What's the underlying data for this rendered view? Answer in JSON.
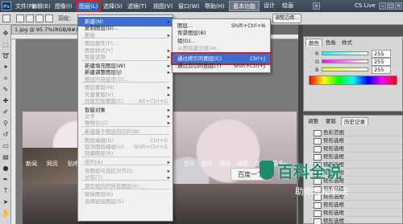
{
  "menubar": {
    "logo": "Ps",
    "items": [
      "文件(F)",
      "编辑(E)",
      "图像(I)",
      "图层(L)",
      "选择(S)",
      "滤镜(T)",
      "视图(V)",
      "窗口(W)",
      "帮助(H)"
    ],
    "zoom": "95.7",
    "workspace_buttons": [
      "基本功能",
      "设计",
      "绘画"
    ],
    "cs_live": "CS Live"
  },
  "options_bar": {
    "labels": [
      "羽化:"
    ],
    "refine_edge_button": "调整边缘..."
  },
  "document": {
    "tab_title": "1.jpg @ 95.7%(RGB/8#)"
  },
  "canvas": {
    "captions": [
      "新闻",
      "网页",
      "贴吧",
      "知道",
      "音乐",
      "图片",
      "视频",
      "地图",
      "文库",
      "更多»"
    ],
    "search_button": "百度一下"
  },
  "layer_menu": {
    "items": [
      {
        "label": "新建(N)",
        "state": "highlight",
        "submenu": true
      },
      {
        "label": "复制图层(D)...",
        "state": "normal"
      },
      {
        "label": "删除",
        "state": "dim",
        "submenu": true
      },
      {
        "sep": true
      },
      {
        "label": "图层属性(P)...",
        "state": "dim"
      },
      {
        "label": "图层样式(Y)",
        "state": "dim",
        "submenu": true
      },
      {
        "label": "智能滤镜",
        "state": "dim",
        "submenu": true
      },
      {
        "sep": true
      },
      {
        "label": "新建填充图层(W)",
        "state": "normal",
        "submenu": true
      },
      {
        "label": "新建调整图层(J)",
        "state": "normal",
        "submenu": true
      },
      {
        "label": "图层内容选项(O)...",
        "state": "dim"
      },
      {
        "sep": true
      },
      {
        "label": "图层蒙版(M)",
        "state": "dim",
        "submenu": true
      },
      {
        "label": "矢量蒙版(V)",
        "state": "dim",
        "submenu": true
      },
      {
        "label": "创建剪贴蒙版(C)",
        "state": "dim",
        "key": "Alt+Ctrl+G"
      },
      {
        "sep": true
      },
      {
        "label": "智能对象",
        "state": "normal",
        "submenu": true
      },
      {
        "label": "文字",
        "state": "dim",
        "submenu": true
      },
      {
        "label": "栅格化(Z)",
        "state": "dim",
        "submenu": true
      },
      {
        "sep": true
      },
      {
        "label": "新建基于图层的切片(B)",
        "state": "dim"
      },
      {
        "sep": true
      },
      {
        "label": "图层编组(G)",
        "state": "dim",
        "key": "Ctrl+G"
      },
      {
        "label": "取消图层编组(U)",
        "state": "dim",
        "key": "Shift+Ctrl+G"
      },
      {
        "label": "隐藏图层(R)",
        "state": "dim"
      },
      {
        "sep": true
      },
      {
        "label": "排列(A)",
        "state": "dim",
        "submenu": true
      },
      {
        "sep": true
      },
      {
        "label": "将图层与选区对齐(I)",
        "state": "dim",
        "submenu": true
      },
      {
        "label": "分布(T)",
        "state": "dim",
        "submenu": true
      },
      {
        "sep": true
      },
      {
        "label": "锁定组内的所有图层(X)...",
        "state": "dim"
      },
      {
        "sep": true
      },
      {
        "label": "链接图层(K)",
        "state": "dim"
      },
      {
        "label": "选择链接图层(S)",
        "state": "dim"
      }
    ]
  },
  "new_submenu": {
    "items": [
      {
        "label": "图层...",
        "key": "Shift+Ctrl+N",
        "state": "normal"
      },
      {
        "label": "背景图层(B)",
        "state": "normal"
      },
      {
        "label": "组(G)...",
        "state": "normal"
      },
      {
        "label": "从图层建立组(A)...",
        "state": "dim"
      },
      {
        "sep": true
      },
      {
        "label": "通过拷贝的图层(C)",
        "key": "Ctrl+J",
        "state": "highlight",
        "boxed": true
      },
      {
        "label": "通过剪切的图层(T)",
        "key": "Shift+Ctrl+J",
        "state": "normal"
      }
    ]
  },
  "color_panel": {
    "tabs": [
      "颜色",
      "色板",
      "样式"
    ],
    "channels": [
      {
        "name": "R",
        "value": "255",
        "gradient": [
          "#00ffff",
          "#ffffff"
        ]
      },
      {
        "name": "G",
        "value": "255",
        "gradient": [
          "#ff00ff",
          "#ffffff"
        ]
      },
      {
        "name": "B",
        "value": "255",
        "gradient": [
          "#ffff00",
          "#ffffff"
        ]
      }
    ]
  },
  "history_panel": {
    "tabs": [
      "调整",
      "蒙版",
      "历史记录"
    ],
    "items": [
      "色彩范围",
      "矩形选框",
      "矩形选框",
      "矩形选框",
      "矩形选框",
      "矩形选框",
      "矩形选框",
      "矩形选框",
      "矩形选框",
      "矩形选框",
      "矩形选框",
      "矩形选框"
    ]
  },
  "watermark": {
    "brand": "百科全说",
    "slogan": "助你轻松解决"
  },
  "colors": {
    "menu_highlight": "#3b6fd1",
    "annotation_red": "#d42020",
    "watermark_green": "#1d8a6b"
  }
}
